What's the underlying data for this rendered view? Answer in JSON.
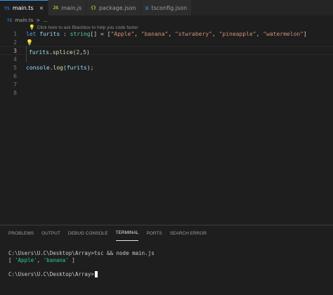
{
  "tabs": [
    {
      "icon": "TS",
      "label": "main.ts",
      "active": true,
      "close": "×"
    },
    {
      "icon": "JS",
      "label": "main.js",
      "active": false
    },
    {
      "icon": "{}",
      "label": "package.json",
      "active": false
    },
    {
      "icon": "⊞",
      "label": "tsconfig.json",
      "active": false
    }
  ],
  "breadcrumb": {
    "icon": "TS",
    "file": "main.ts",
    "sep": ">",
    "rest": "..."
  },
  "editor": {
    "hint": "Click here to ask Blackbox to help you code faster",
    "line_numbers": [
      "1",
      "2",
      "3",
      "4",
      "5",
      "6",
      "7",
      "8"
    ],
    "line1": {
      "kw": "let",
      "name": " furits ",
      "colon": ": ",
      "type": "string",
      "brk": "[] = [",
      "s1": "\"Apple\"",
      "c1": ", ",
      "s2": "\"banana\"",
      "c2": ", ",
      "s3": "\"stwrabery\"",
      "c3": ", ",
      "s4": "\"pineapple\"",
      "c4": ", ",
      "s5": "\"watermelon\"",
      "end": "]"
    },
    "line3": {
      "obj": "furits",
      "dot": ".",
      "fn": "splice",
      "open": "(",
      "n1": "2",
      "comma": ",",
      "n2": "5",
      "close": ")"
    },
    "line5": {
      "obj": "console",
      "dot": ".",
      "fn": "log",
      "open": "(",
      "arg": "furits",
      "close": ");"
    }
  },
  "panel": {
    "tabs": [
      "PROBLEMS",
      "OUTPUT",
      "DEBUG CONSOLE",
      "TERMINAL",
      "PORTS",
      "SEARCH ERROR"
    ],
    "active_tab": "TERMINAL",
    "terminal": {
      "cmd_line": "C:\\Users\\U.C\\Desktop\\Array>tsc && node main.js",
      "out_open": "[ ",
      "out_s1": "'Apple'",
      "out_comma": ", ",
      "out_s2": "'banana'",
      "out_close": " ]",
      "prompt": "C:\\Users\\U.C\\Desktop\\Array>"
    }
  }
}
